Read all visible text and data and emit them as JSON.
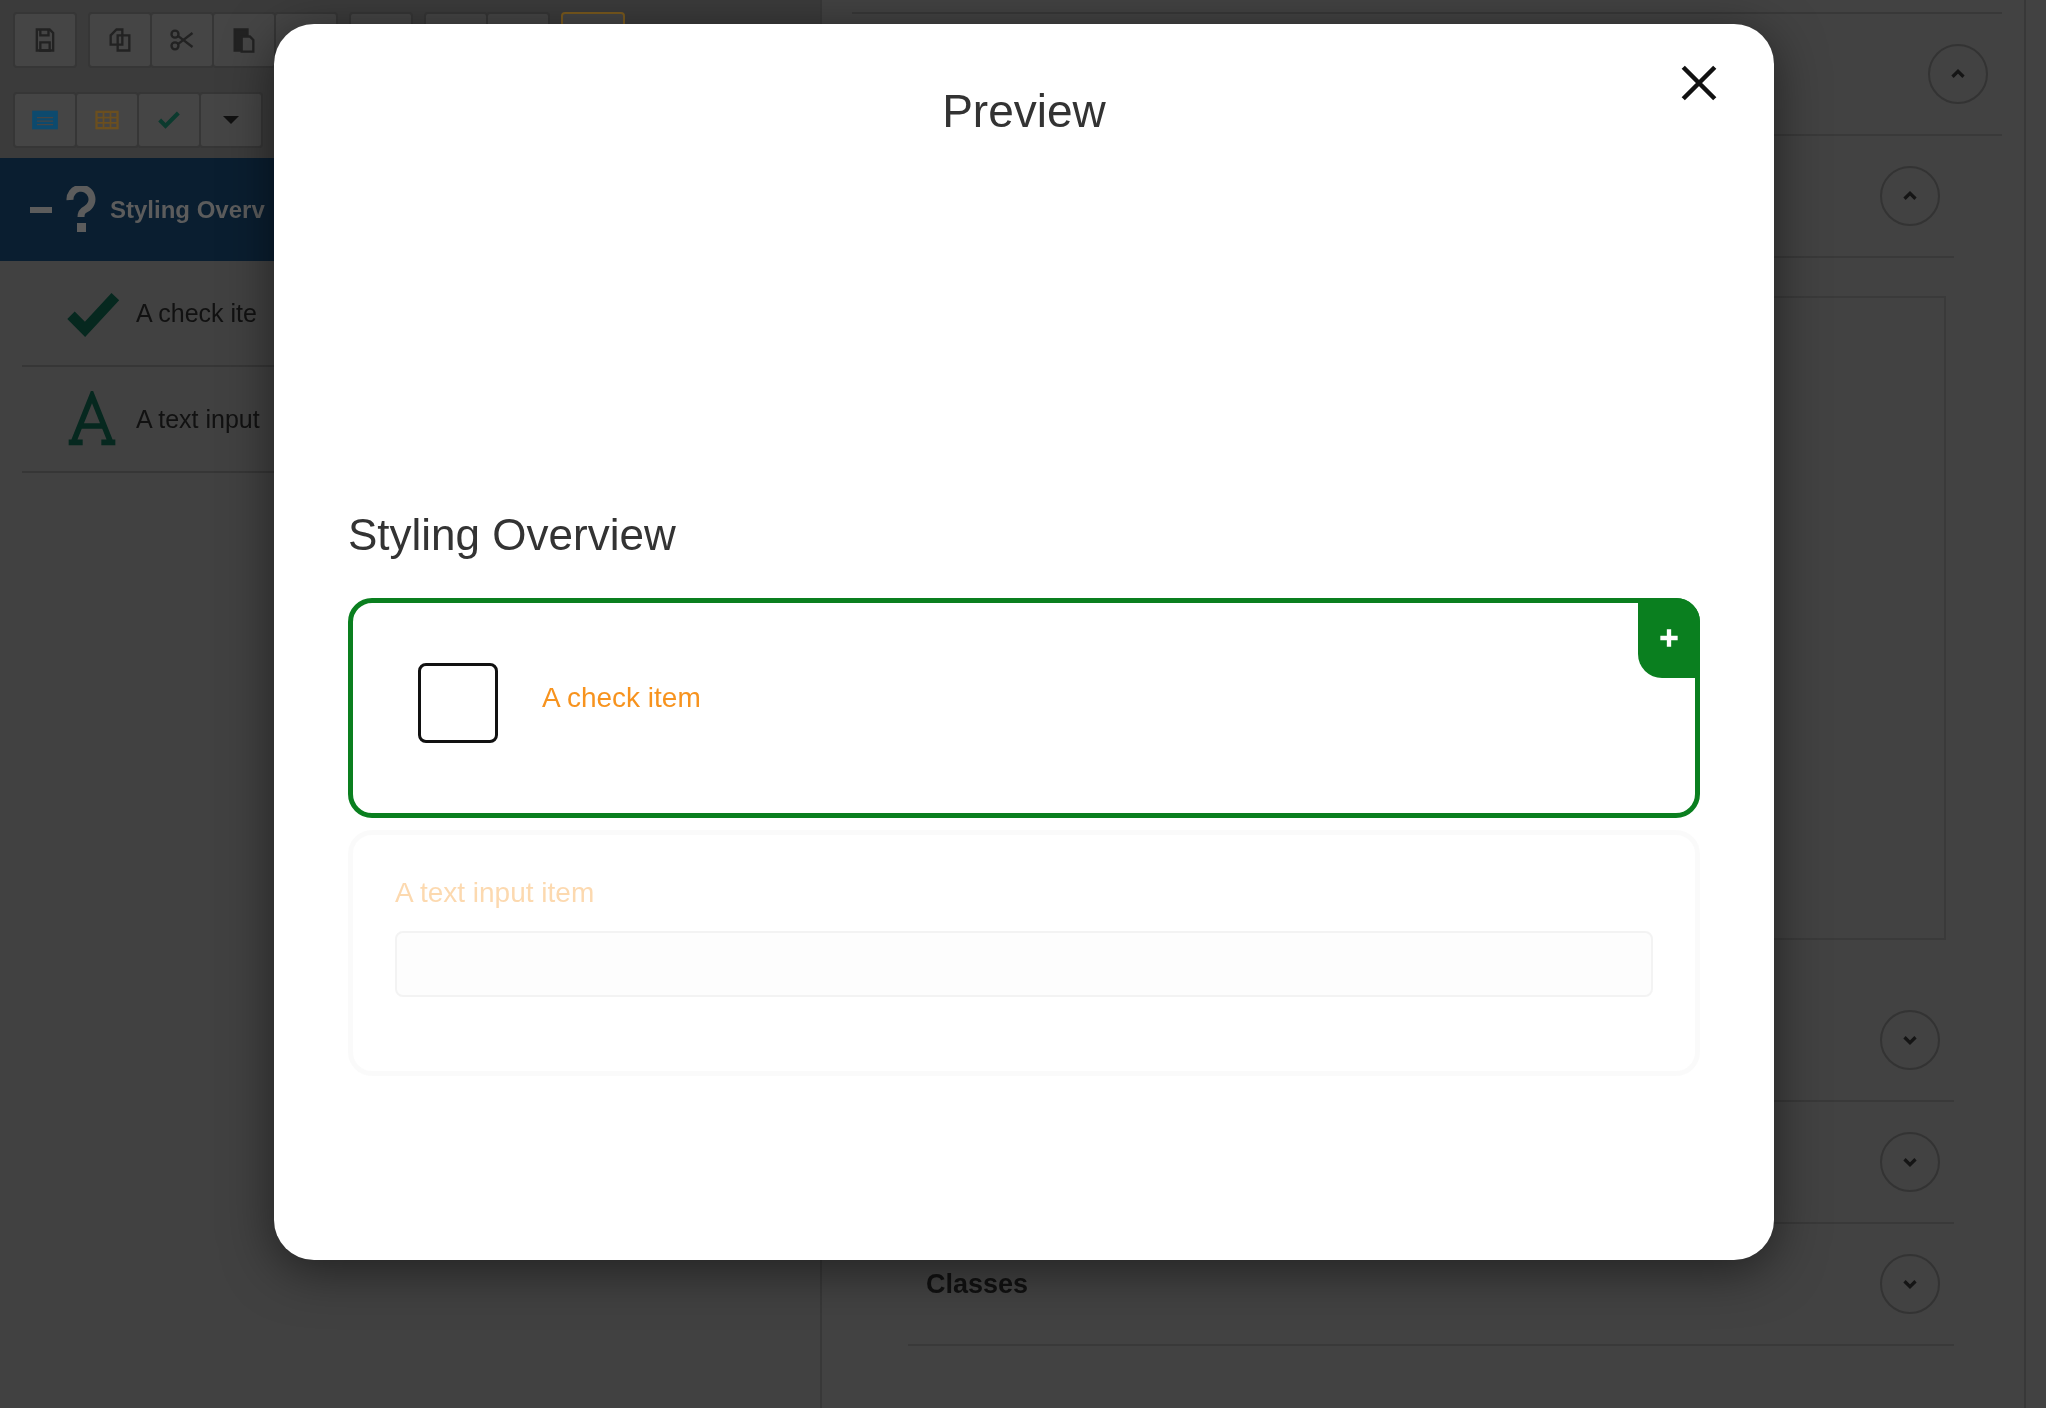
{
  "tree": {
    "label": "Styling Overv",
    "expanded": true,
    "selected": true,
    "children": [
      {
        "kind": "check",
        "label": "A check ite"
      },
      {
        "kind": "text",
        "label": "A text input"
      }
    ]
  },
  "properties": {
    "sections": [
      {
        "expanded": true
      },
      {
        "expanded": true
      },
      {
        "expanded": false
      },
      {
        "expanded": false
      },
      {
        "label": "Classes",
        "expanded": false
      }
    ]
  },
  "preview": {
    "title": "Preview",
    "heading": "Styling Overview",
    "items": [
      {
        "kind": "check",
        "label": "A check item",
        "checked": false,
        "selected": true,
        "disabled": false
      },
      {
        "kind": "text",
        "label": "A text input item",
        "selected": false,
        "disabled": true
      }
    ]
  }
}
